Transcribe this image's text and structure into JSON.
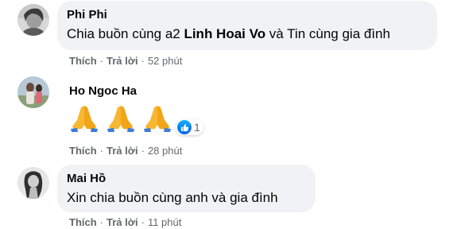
{
  "comments": [
    {
      "author": "Phi Phi",
      "text_before": "Chia buồn cùng a2 ",
      "tagged_name": "Linh Hoai Vo",
      "text_after": " và Tin cùng gia đình",
      "like_label": "Thích",
      "reply_label": "Trả lời",
      "time": "52 phút"
    },
    {
      "author": "Ho Ngoc Ha",
      "emoji_count_text": "1",
      "like_label": "Thích",
      "reply_label": "Trả lời",
      "time": "28 phút"
    },
    {
      "author": "Mai Hồ",
      "text": "Xin chia buồn cùng anh và gia đình",
      "like_label": "Thích",
      "reply_label": "Trả lời",
      "time": "11 phút"
    }
  ],
  "separator": "·",
  "icons": {
    "reaction": "like-icon",
    "emoji": "folded-hands-emoji"
  },
  "colors": {
    "bubble": "#f0f2f5",
    "meta": "#65676b",
    "like_blue": "#1877f2"
  }
}
